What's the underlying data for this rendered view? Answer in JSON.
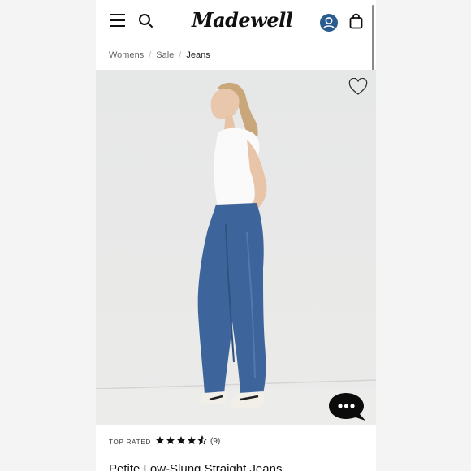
{
  "brand": {
    "logo_text": "Madewell"
  },
  "header": {
    "menu_icon": "hamburger-menu-icon",
    "search_icon": "search-icon",
    "account_icon": "user-account-icon",
    "account_color": "#2b5c8f",
    "bag_icon": "shopping-bag-icon"
  },
  "breadcrumb": {
    "items": [
      "Womens",
      "Sale",
      "Jeans"
    ],
    "separator": "/"
  },
  "product": {
    "image_alt": "Model wearing blue straight-leg jeans and white t-shirt",
    "wishlist_icon": "heart-icon",
    "badge": "TOP RATED",
    "rating": 4.5,
    "review_count": "(9)",
    "title": "Petite Low-Slung Straight Jeans"
  },
  "chat": {
    "icon": "chat-bubble-icon"
  }
}
